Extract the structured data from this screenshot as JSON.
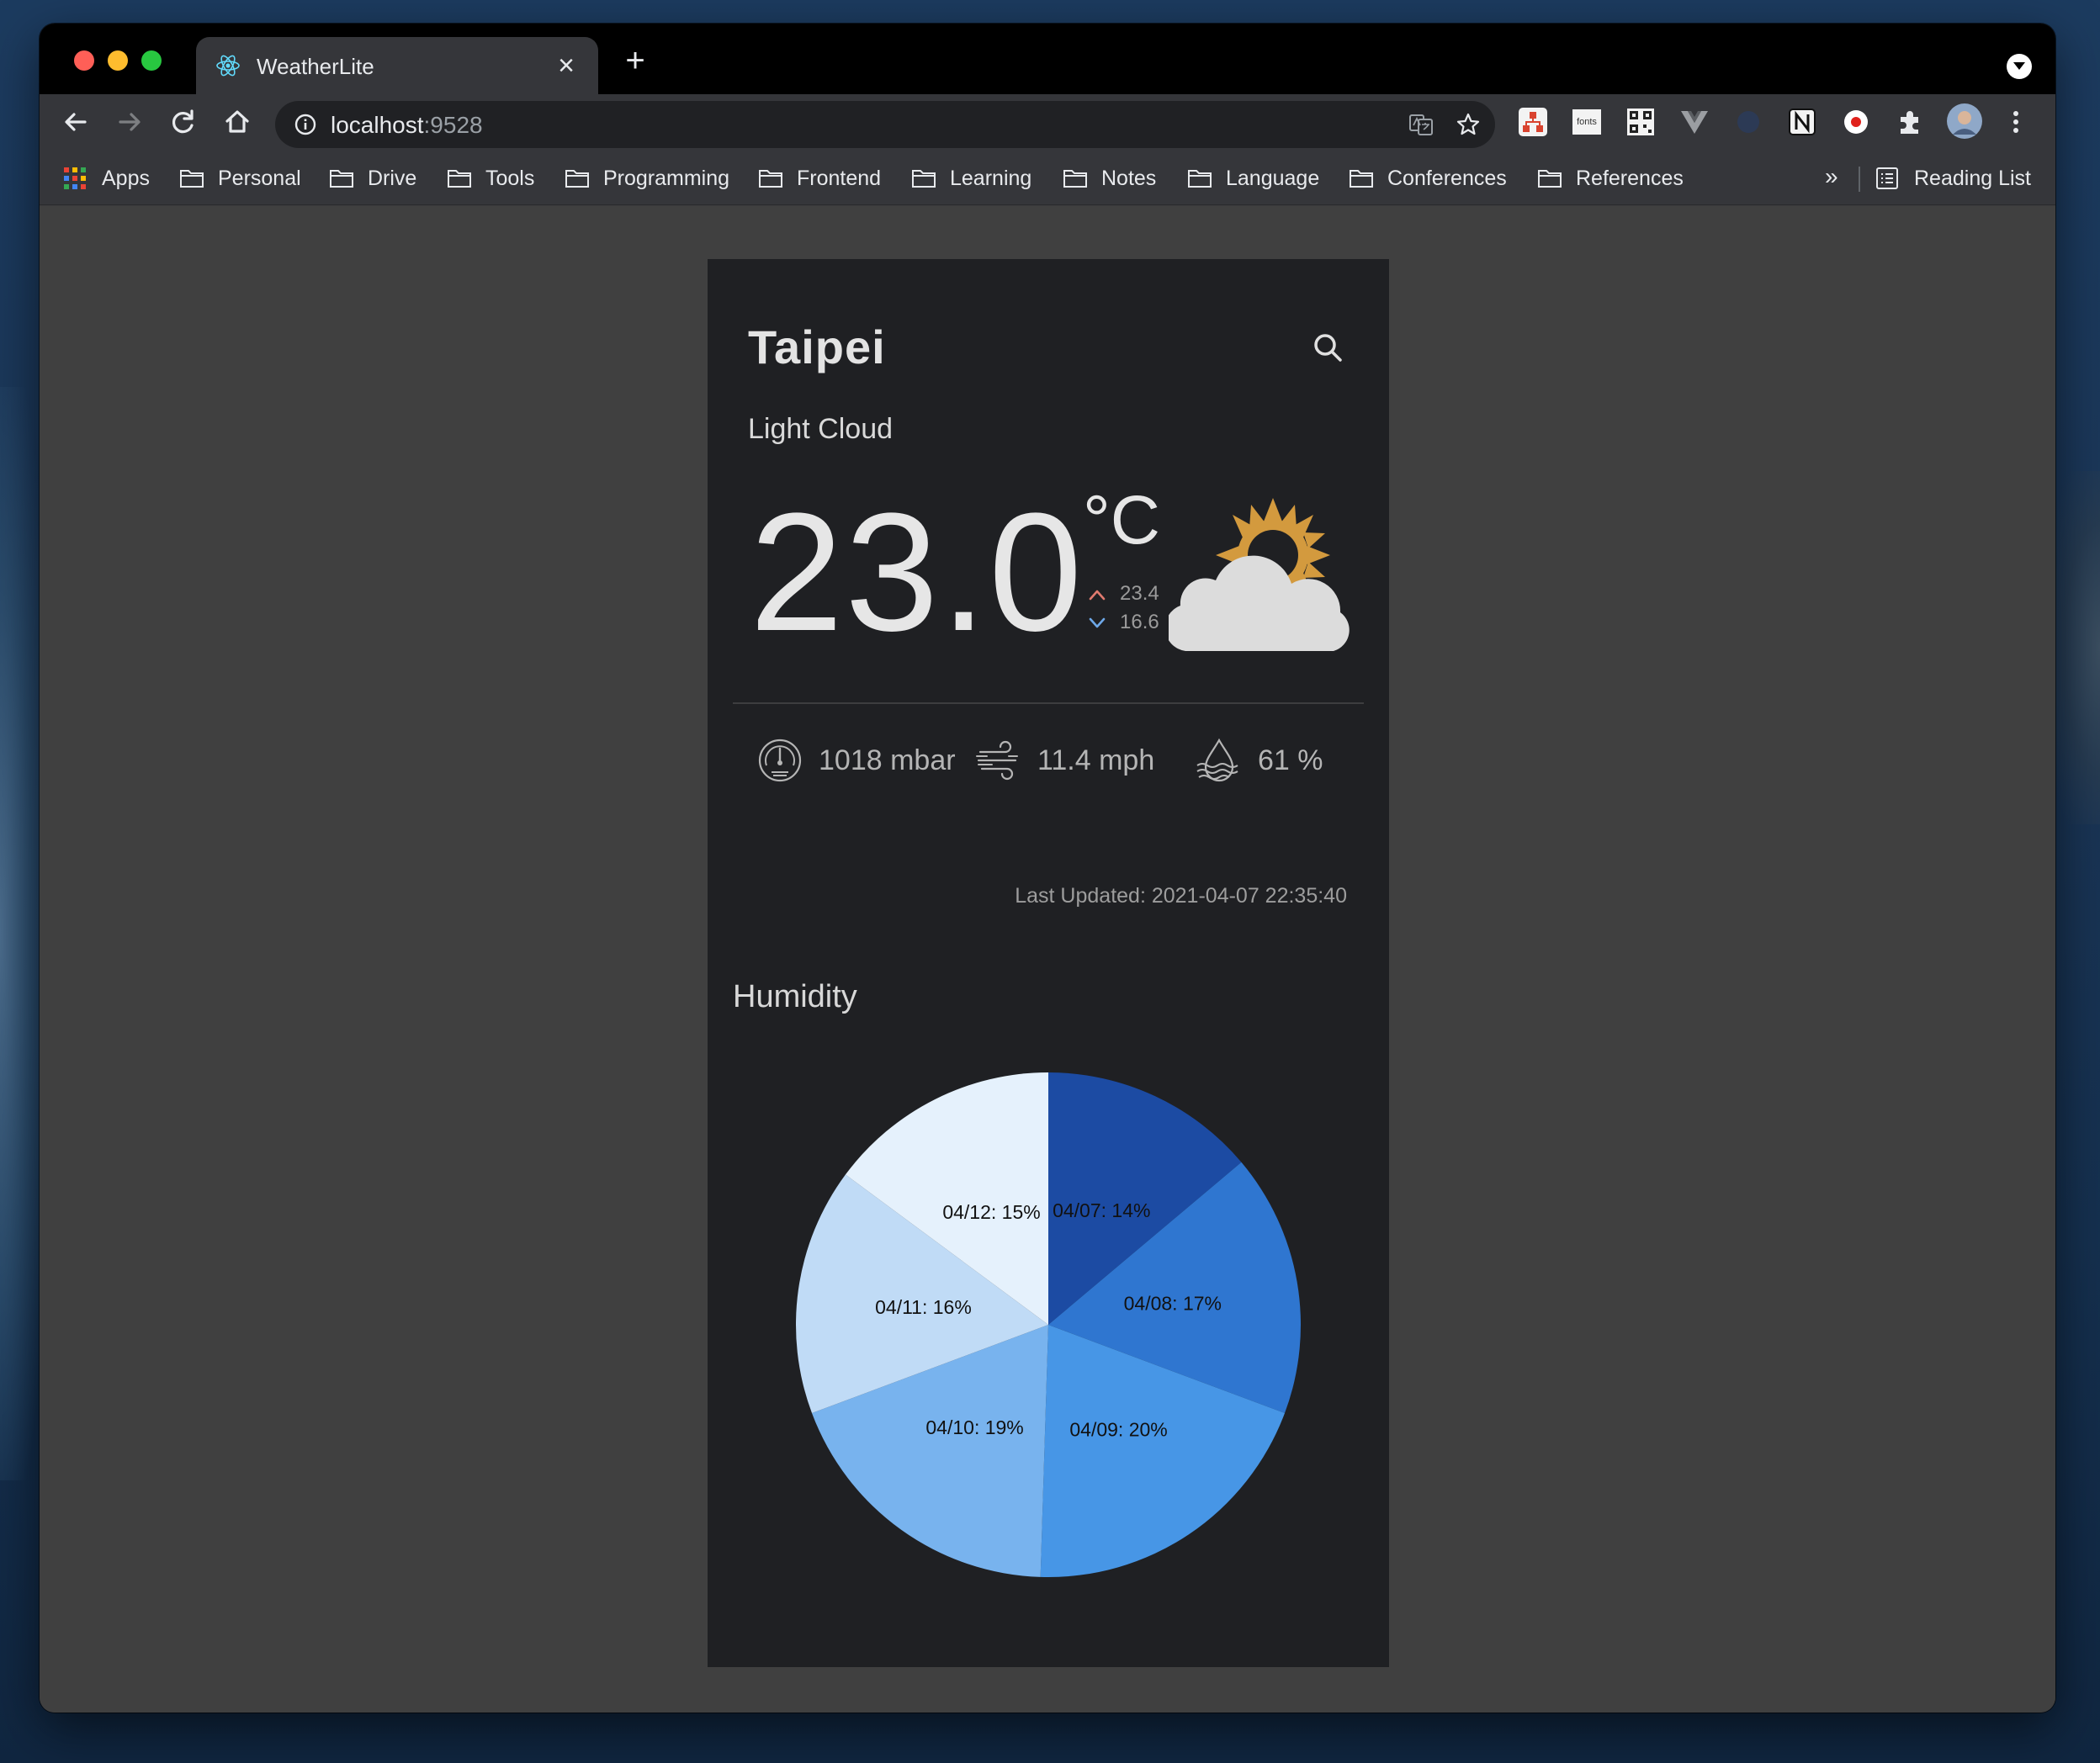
{
  "browser": {
    "tab_title": "WeatherLite",
    "url_host": "localhost",
    "url_port": ":9528",
    "bookmarks": [
      "Apps",
      "Personal",
      "Drive",
      "Tools",
      "Programming",
      "Frontend",
      "Learning",
      "Notes",
      "Language",
      "Conferences",
      "References"
    ],
    "overflow": "»",
    "reading_list": "Reading List"
  },
  "weather": {
    "city": "Taipei",
    "description": "Light Cloud",
    "temperature": "23.0",
    "unit": "°C",
    "high": "23.4",
    "low": "16.6",
    "pressure": "1018 mbar",
    "wind": "11.4 mph",
    "humidity": "61 %",
    "last_updated": "Last Updated: 2021-04-07 22:35:40"
  },
  "chart_title": "Humidity",
  "chart_data": {
    "type": "pie",
    "title": "Humidity",
    "categories": [
      "04/07",
      "04/08",
      "04/09",
      "04/10",
      "04/11",
      "04/12"
    ],
    "values": [
      14,
      17,
      20,
      19,
      16,
      15
    ],
    "labels": [
      "04/07: 14%",
      "04/08: 17%",
      "04/09: 20%",
      "04/10: 19%",
      "04/11: 16%",
      "04/12: 15%"
    ],
    "colors": [
      "#1c4ba3",
      "#2f76d0",
      "#4796e6",
      "#78b3ee",
      "#c0dbf6",
      "#e5f1fc"
    ]
  }
}
